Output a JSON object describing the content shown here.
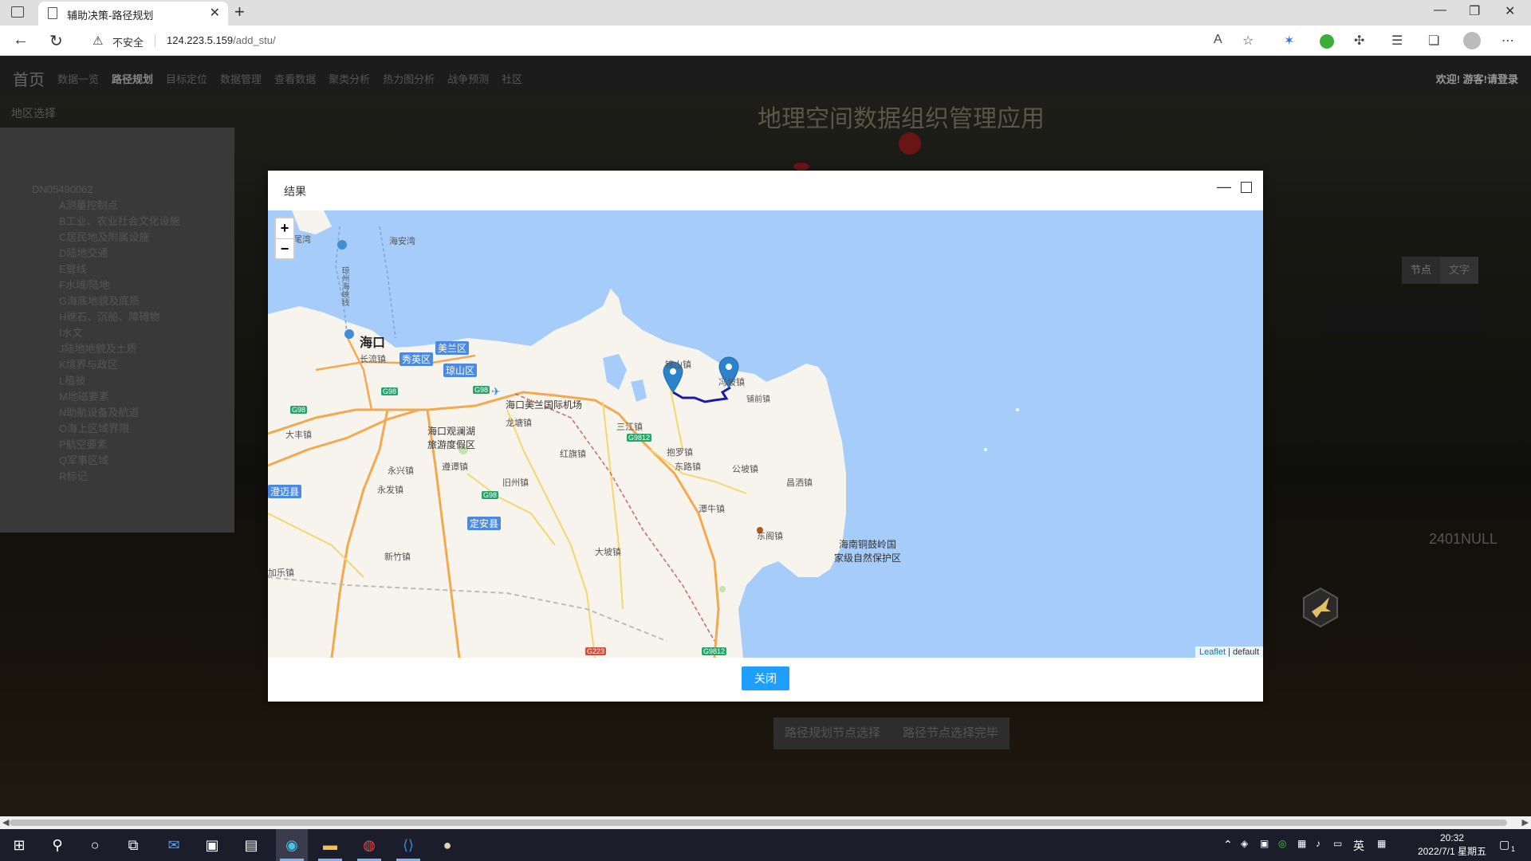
{
  "browser": {
    "tab_title": "辅助决策-路径规划",
    "security_label": "不安全",
    "url_host": "124.223.5.159",
    "url_path": "/add_stu/"
  },
  "site": {
    "brand": "首页",
    "nav": [
      "数据一览",
      "路径规划",
      "目标定位",
      "数据管理",
      "查看数据",
      "聚类分析",
      "热力图分析",
      "战争预测",
      "社区"
    ],
    "nav_active": "路径规划",
    "user_text": "欢迎! 游客!请登录",
    "bg_title": "地理空间数据组织管理应用",
    "region_label": "地区选择",
    "tree_root": "DN05490062",
    "tree_items": [
      "A测量控制点",
      "B工业、农业社会文化设施",
      "C居民地及附属设施",
      "D陆地交通",
      "E管线",
      "F水域/陆地",
      "G海底地貌及底质",
      "H礁石、沉船、障碍物",
      "I水文",
      "J陆地地貌及土质",
      "K境界与政区",
      "L植被",
      "M地磁要素",
      "N助航设备及航道",
      "O海上区域界限",
      "P航空要素",
      "Q军事区域",
      "R标记"
    ],
    "seg_node": "节点",
    "seg_text": "文字",
    "null_text": "2401NULL",
    "btn_select_nodes": "路径规划节点选择",
    "btn_select_done": "路径节点选择完毕"
  },
  "modal": {
    "title": "结果",
    "close_label": "关闭",
    "zoom_in": "+",
    "zoom_out": "−",
    "attribution_link": "Leaflet",
    "attribution_rest": " | default"
  },
  "map_labels": {
    "city": "海口",
    "haian": "海安湾",
    "weiwan": "尾湾",
    "meilan": "美兰区",
    "xiuying": "秀英区",
    "qiongshan": "琼山区",
    "changliu": "长流镇",
    "airport": "海口美兰国际机场",
    "guanlanhu": "海口观澜湖\n旅游度假区",
    "longtang": "龙塘镇",
    "sanjiang": "三江镇",
    "jinshan": "锦山镇",
    "fengpo": "冯坡镇",
    "pantun": "铺前镇",
    "dachang": "大丰镇",
    "zunzan": "遵谭镇",
    "hongqi": "红旗镇",
    "yongxing": "永兴镇",
    "jiuzhou": "旧州镇",
    "yongfa": "永发镇",
    "dongzhai": "东路镇",
    "baoluo": "抱罗镇",
    "gongpo": "公坡镇",
    "changsa": "昌洒镇",
    "tanniu": "潭牛镇",
    "donggo": "东阁镇",
    "dingan": "定安县",
    "chengmai": "澄迈县",
    "xinzhu": "新竹镇",
    "dapo": "大坡镇",
    "ledong": "加乐镇",
    "reserve": "海南铜鼓岭国\n家级自然保护区",
    "route_line": "琼州海峡线"
  },
  "highways": [
    "G98",
    "G98",
    "G98",
    "G98",
    "G9812",
    "G9812",
    "G223"
  ],
  "taskbar": {
    "ime": "英",
    "time": "20:32",
    "date": "2022/7/1 星期五",
    "notif": "1"
  },
  "colors": {
    "accent": "#1e9fff",
    "route": "#1a1aa8",
    "marker": "#2b83cb",
    "sea": "#a6cdfa",
    "land": "#f7f4ed"
  }
}
